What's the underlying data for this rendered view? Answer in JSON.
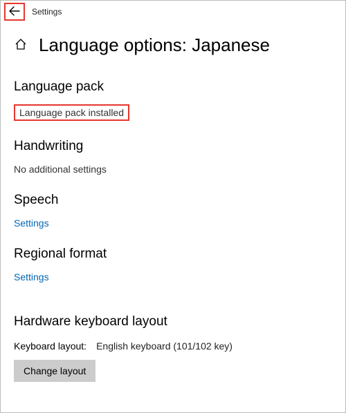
{
  "app": {
    "title": "Settings"
  },
  "page": {
    "title": "Language options: Japanese"
  },
  "sections": {
    "language_pack": {
      "heading": "Language pack",
      "status": "Language pack installed"
    },
    "handwriting": {
      "heading": "Handwriting",
      "status": "No additional settings"
    },
    "speech": {
      "heading": "Speech",
      "link": "Settings"
    },
    "regional_format": {
      "heading": "Regional format",
      "link": "Settings"
    },
    "hardware_keyboard": {
      "heading": "Hardware keyboard layout",
      "layout_label": "Keyboard layout:",
      "layout_value": "English keyboard (101/102 key)",
      "change_button": "Change layout"
    }
  },
  "colors": {
    "link": "#0066b4",
    "highlight": "#e5362e",
    "button_bg": "#cccccc"
  }
}
